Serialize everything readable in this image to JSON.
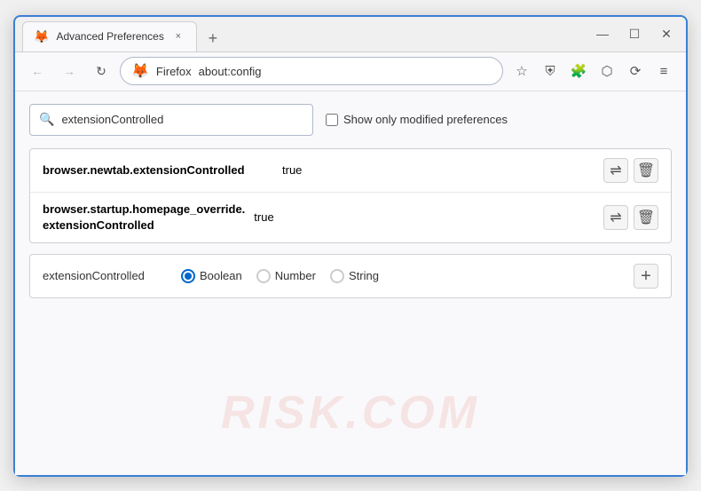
{
  "window": {
    "title": "Advanced Preferences",
    "tab_close": "×",
    "new_tab": "+",
    "minimize": "—",
    "maximize": "☐",
    "close": "✕"
  },
  "nav": {
    "back": "←",
    "forward": "→",
    "refresh": "↻",
    "browser_name": "Firefox",
    "address": "about:config",
    "bookmark_icon": "☆",
    "shield_icon": "⛨",
    "extension_icon": "🧩",
    "screenshot_icon": "⬡",
    "sync_icon": "⟳",
    "menu_icon": "≡"
  },
  "search": {
    "value": "extensionControlled",
    "placeholder": "Search preference name",
    "checkbox_label": "Show only modified preferences"
  },
  "results": [
    {
      "name": "browser.newtab.extensionControlled",
      "value": "true"
    },
    {
      "name_line1": "browser.startup.homepage_override.",
      "name_line2": "extensionControlled",
      "value": "true"
    }
  ],
  "new_pref": {
    "name": "extensionControlled",
    "types": [
      "Boolean",
      "Number",
      "String"
    ],
    "selected_type": "Boolean"
  },
  "watermark": "RISK.COM",
  "colors": {
    "accent": "#3b7fd4",
    "radio_selected": "#0066cc"
  }
}
